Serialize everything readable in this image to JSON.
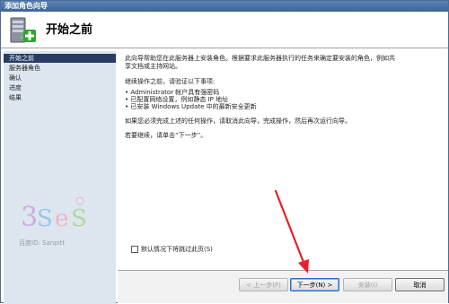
{
  "window": {
    "title": "添加角色向导"
  },
  "header": {
    "title": "开始之前"
  },
  "sidebar": {
    "items": [
      {
        "label": "开始之前"
      },
      {
        "label": "服务器角色"
      },
      {
        "label": "确认"
      },
      {
        "label": "进度"
      },
      {
        "label": "结果"
      }
    ]
  },
  "content": {
    "intro_line1": "此向导帮助您在此服务器上安装角色。根据要求此服务器执行的任务来确定要安装的角色，例如共",
    "intro_line2": "享文档或主持网站。",
    "verify_heading": "继续操作之前，请验证以下事项:",
    "bullets": [
      "Administrator 帐户具有强密码",
      "已配置网络设置，例如静态 IP 地址",
      "已安装 Windows Update 中的最新安全更新"
    ],
    "note": "如果您必须完成上述的任何操作，请取消此向导，完成操作，然后再次运行向导。",
    "continue": "若要继续，请单击“下一步”。",
    "skip_checkbox_label": "默认情况下将跳过此页(S)"
  },
  "watermark": {
    "line1": "百度ID: Sanpitt"
  },
  "buttons": {
    "back": "< 上一步(P)",
    "next": "下一步(N) >",
    "install": "安装(I)",
    "cancel": "取消"
  },
  "colors": {
    "nav_active": "#283c64",
    "sidebar_bg": "#dde6ef",
    "arrow": "#e8202a"
  }
}
